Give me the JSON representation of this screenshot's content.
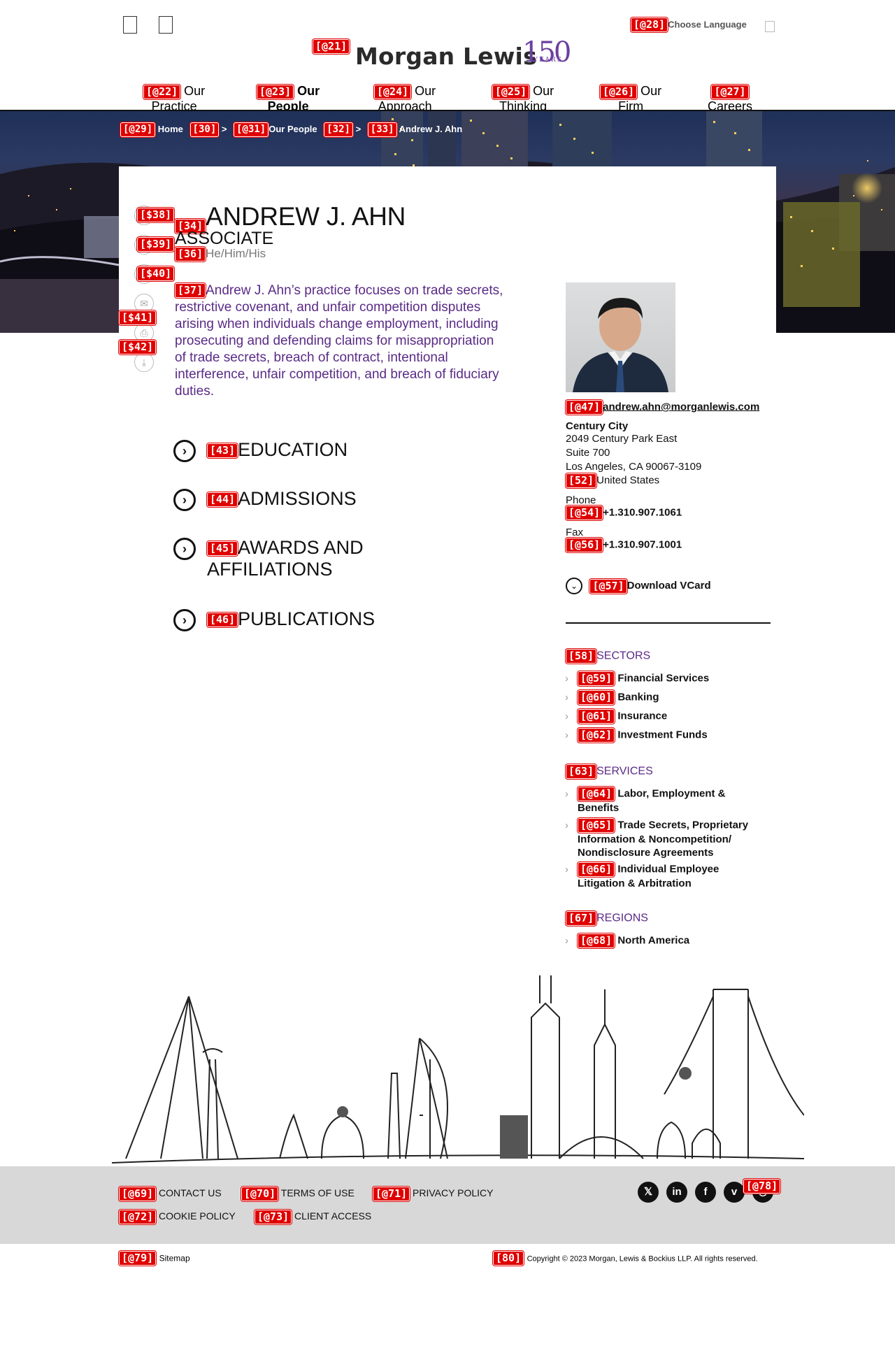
{
  "header": {
    "choose_language": "Choose Language",
    "logo_text": "Morgan Lewis",
    "anniversary_number": "150",
    "anniversary_label": "YEARS",
    "tags": {
      "logo": "[@21]",
      "language": "[@28]"
    }
  },
  "nav": [
    {
      "tag": "[@22]",
      "label1": "Our",
      "label2": "Practice"
    },
    {
      "tag": "[@23]",
      "label1": "Our",
      "label2": "People"
    },
    {
      "tag": "[@24]",
      "label1": "Our",
      "label2": "Approach"
    },
    {
      "tag": "[@25]",
      "label1": "Our",
      "label2": "Thinking"
    },
    {
      "tag": "[@26]",
      "label1": "Our",
      "label2": "Firm"
    },
    {
      "tag": "[@27]",
      "label1": "",
      "label2": "Careers"
    }
  ],
  "breadcrumb": {
    "home_tag": "[@29]",
    "home": "Home",
    "sep1_tag": "[30]",
    "sep": ">",
    "people_tag": "[@31]",
    "people": "Our People",
    "sep2_tag": "[32]",
    "current_tag": "[33]",
    "current": "Andrew J. Ahn"
  },
  "profile": {
    "name_tag": "[34]",
    "name": "ANDREW J. AHN",
    "title": "ASSOCIATE",
    "pronoun_tag": "[36]",
    "pronouns": "He/Him/His",
    "bio_tag": "[37]",
    "bio": "Andrew J. Ahn’s practice focuses on trade secrets, restrictive covenant, and unfair competition disputes arising when individuals change employment, including prosecuting and defending claims for misappropriation of trade secrets, breach of contract, intentional interference, unfair competition, and breach of fiduciary duties.",
    "share_tags": [
      "[$38]",
      "[$39]",
      "[$40]",
      "[$41]",
      "[$42]"
    ]
  },
  "sections": [
    {
      "tag": "[43]",
      "line1": "EDUCATION",
      "line2": ""
    },
    {
      "tag": "[44]",
      "line1": "ADMISSIONS",
      "line2": ""
    },
    {
      "tag": "[45]",
      "line1": "AWARDS AND",
      "line2": "AFFILIATIONS"
    },
    {
      "tag": "[46]",
      "line1": "PUBLICATIONS",
      "line2": ""
    }
  ],
  "contact": {
    "email_tag": "[@47]",
    "email": "andrew.ahn@morganlewis.com",
    "office": "Century City",
    "addr1": "2049 Century Park East",
    "addr2": "Suite 700",
    "addr3": "Los Angeles, CA 90067-3109",
    "country_tag": "[52]",
    "country": "United States",
    "phone_label": "Phone",
    "phone_tag": "[@54]",
    "phone": "+1.310.907.1061",
    "fax_label": "Fax",
    "fax_tag": "[@56]",
    "fax": "+1.310.907.1001",
    "vcard_tag": "[@57]",
    "vcard": "Download VCard"
  },
  "sectors": {
    "tag": "[58]",
    "heading": "SECTORS",
    "items": [
      {
        "tag": "[@59]",
        "label": "Financial Services"
      },
      {
        "tag": "[@60]",
        "label": "Banking"
      },
      {
        "tag": "[@61]",
        "label": "Insurance"
      },
      {
        "tag": "[@62]",
        "label": "Investment Funds"
      }
    ]
  },
  "services": {
    "tag": "[63]",
    "heading": "SERVICES",
    "items": [
      {
        "tag": "[@64]",
        "label": "Labor, Employment & Benefits"
      },
      {
        "tag": "[@65]",
        "label": "Trade Secrets, Proprietary Information & Noncompetition/ Nondisclosure Agreements"
      },
      {
        "tag": "[@66]",
        "label": "Individual Employee Litigation & Arbitration"
      }
    ]
  },
  "regions": {
    "tag": "[67]",
    "heading": "REGIONS",
    "items": [
      {
        "tag": "[@68]",
        "label": "North America"
      }
    ]
  },
  "footer": {
    "links": [
      {
        "tag": "[@69]",
        "label": "CONTACT US"
      },
      {
        "tag": "[@70]",
        "label": "TERMS OF USE"
      },
      {
        "tag": "[@71]",
        "label": "PRIVACY POLICY"
      },
      {
        "tag": "[@72]",
        "label": "COOKIE POLICY"
      },
      {
        "tag": "[@73]",
        "label": "CLIENT ACCESS"
      }
    ],
    "social_tag": "[@78]",
    "social": [
      {
        "icon": "x-icon",
        "glyph": "𝕏"
      },
      {
        "icon": "linkedin-icon",
        "glyph": "in"
      },
      {
        "icon": "facebook-icon",
        "glyph": "f"
      },
      {
        "icon": "vimeo-icon",
        "glyph": "v"
      },
      {
        "icon": "instagram-icon",
        "glyph": "◎"
      }
    ],
    "sitemap_tag": "[@79]",
    "sitemap": "Sitemap",
    "copyright_tag": "[80]",
    "copyright": "Copyright © 2023 Morgan, Lewis & Bockius LLP. All rights reserved."
  },
  "colors": {
    "brand_purple": "#5a2a86",
    "tag_red": "#e00000",
    "footer_gray": "#d8d8d8"
  }
}
